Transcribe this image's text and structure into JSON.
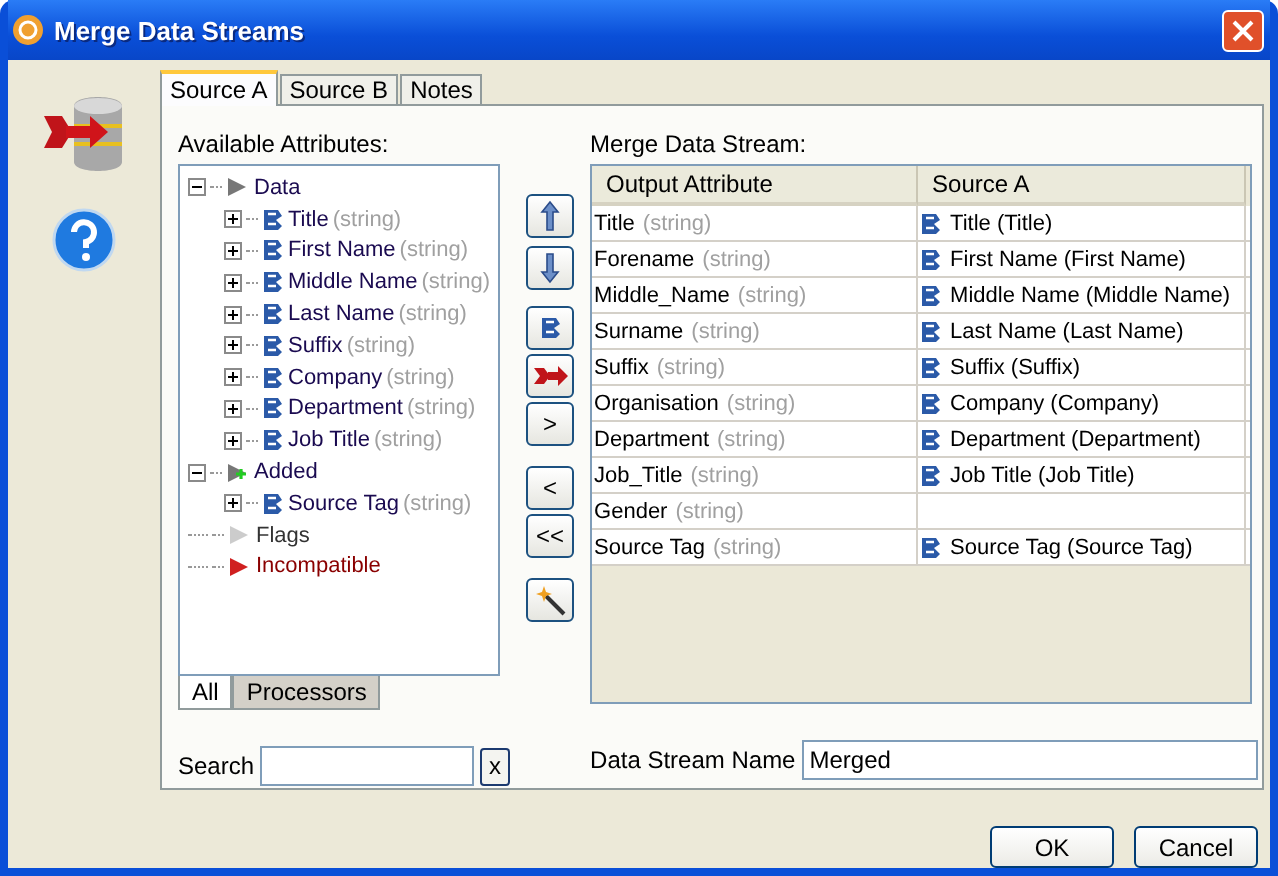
{
  "window": {
    "title": "Merge Data Streams"
  },
  "tabs": [
    {
      "label": "Source A",
      "selected": true
    },
    {
      "label": "Source B",
      "selected": false
    },
    {
      "label": "Notes",
      "selected": false
    }
  ],
  "available_attributes": {
    "label": "Available Attributes:",
    "tree": [
      {
        "label": "Data",
        "kind": "data",
        "expanded": true,
        "children": [
          {
            "label": "Title",
            "type": "(string)",
            "kind": "attribute",
            "expanded": false
          },
          {
            "label": "First Name",
            "type": "(string)",
            "kind": "attribute",
            "expanded": false
          },
          {
            "label": "Middle Name",
            "type": "(string)",
            "kind": "attribute",
            "expanded": false
          },
          {
            "label": "Last Name",
            "type": "(string)",
            "kind": "attribute",
            "expanded": false
          },
          {
            "label": "Suffix",
            "type": "(string)",
            "kind": "attribute",
            "expanded": false
          },
          {
            "label": "Company",
            "type": "(string)",
            "kind": "attribute",
            "expanded": false
          },
          {
            "label": "Department",
            "type": "(string)",
            "kind": "attribute",
            "expanded": false
          },
          {
            "label": "Job Title",
            "type": "(string)",
            "kind": "attribute",
            "expanded": false
          }
        ]
      },
      {
        "label": "Added",
        "kind": "added",
        "expanded": true,
        "children": [
          {
            "label": "Source Tag",
            "type": "(string)",
            "kind": "attribute",
            "expanded": false
          }
        ]
      },
      {
        "label": "Flags",
        "kind": "flags"
      },
      {
        "label": "Incompatible",
        "kind": "incompatible"
      }
    ]
  },
  "filter_tabs": [
    {
      "label": "All",
      "selected": true
    },
    {
      "label": "Processors",
      "selected": false
    }
  ],
  "search": {
    "label": "Search",
    "clear": "x"
  },
  "move_buttons": [
    {
      "kind": "up"
    },
    {
      "kind": "down"
    },
    {
      "kind": "attribute"
    },
    {
      "kind": "merge"
    },
    {
      "kind": "text",
      "label": ">"
    },
    {
      "kind": "text",
      "label": "<"
    },
    {
      "kind": "text",
      "label": "<<"
    },
    {
      "kind": "wand"
    }
  ],
  "merge": {
    "label": "Merge Data Stream:",
    "columns": [
      "Output Attribute",
      "Source A"
    ],
    "rows": [
      {
        "name": "Title",
        "type": "(string)",
        "source": "Title (Title)"
      },
      {
        "name": "Forename",
        "type": "(string)",
        "source": "First Name (First Name)"
      },
      {
        "name": "Middle_Name",
        "type": "(string)",
        "source": "Middle Name (Middle Name)"
      },
      {
        "name": "Surname",
        "type": "(string)",
        "source": "Last Name (Last Name)"
      },
      {
        "name": "Suffix",
        "type": "(string)",
        "source": "Suffix (Suffix)"
      },
      {
        "name": "Organisation",
        "type": "(string)",
        "source": "Company (Company)"
      },
      {
        "name": "Department",
        "type": "(string)",
        "source": "Department (Department)"
      },
      {
        "name": "Job_Title",
        "type": "(string)",
        "source": "Job Title (Job Title)"
      },
      {
        "name": "Gender",
        "type": "(string)"
      },
      {
        "name": "Source Tag",
        "type": "(string)",
        "source": "Source Tag (Source Tag)"
      }
    ]
  },
  "stream_name": {
    "label": "Data Stream Name",
    "value": "Merged"
  },
  "buttons": [
    "OK",
    "Cancel"
  ]
}
